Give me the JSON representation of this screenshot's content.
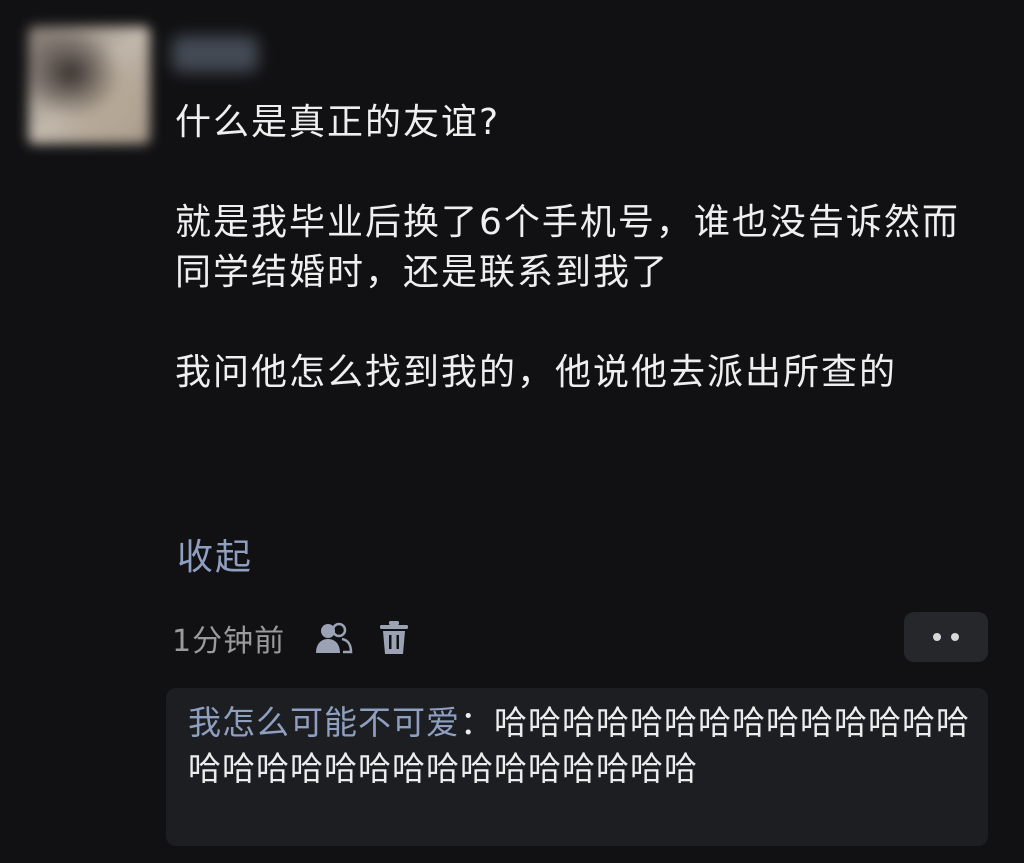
{
  "comment": {
    "username": "叮咚",
    "paragraphs": [
      "什么是真正的友谊?",
      "就是我毕业后换了6个手机号，谁也没告诉然而同学结婚时，还是联系到我了",
      "我问他怎么找到我的，他说他去派出所查的"
    ],
    "collapse_label": "收起",
    "time": "1分钟前",
    "icons": {
      "mention": "people-icon",
      "delete": "trash-icon",
      "more": "more-dots-icon"
    }
  },
  "reply": {
    "author": "我怎么可能不可爱",
    "separator": "：",
    "text": "哈哈哈哈哈哈哈哈哈哈哈哈哈哈哈哈哈哈哈哈哈哈哈哈哈哈哈哈哈"
  },
  "colors": {
    "background": "#111113",
    "link": "#8f9fc0",
    "secondary_text": "#9a9a9a",
    "reply_background": "#1d1e22"
  }
}
